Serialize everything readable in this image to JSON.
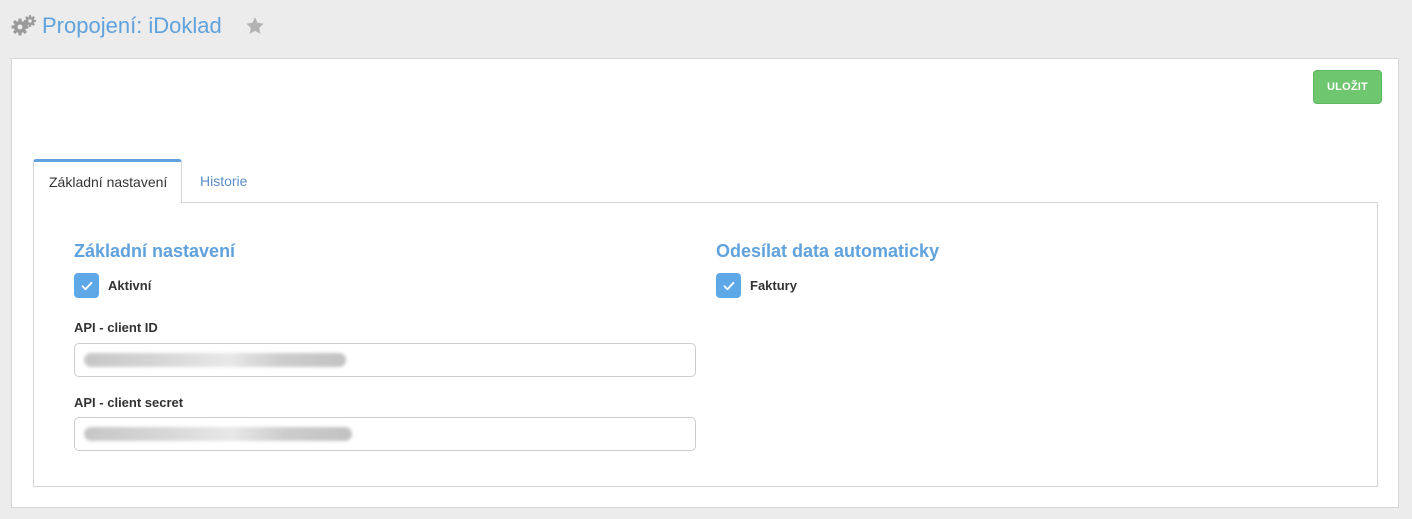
{
  "header": {
    "title": "Propojení: iDoklad",
    "icon": "gears-icon",
    "favorite_icon": "star-icon"
  },
  "toolbar": {
    "save_label": "ULOŽIT"
  },
  "tabs": [
    {
      "label": "Základní nastavení",
      "active": true
    },
    {
      "label": "Historie",
      "active": false
    }
  ],
  "basic_settings": {
    "title": "Základní nastavení",
    "active_checkbox": {
      "label": "Aktivní",
      "checked": true
    },
    "client_id": {
      "label": "API - client ID",
      "value": ""
    },
    "client_secret": {
      "label": "API - client secret",
      "value": ""
    }
  },
  "auto_send": {
    "title": "Odesílat data automaticky",
    "invoices_checkbox": {
      "label": "Faktury",
      "checked": true
    }
  },
  "colors": {
    "accent": "#5fa2dd",
    "save_button": "#6ec66e",
    "checkbox": "#5fa8e8"
  }
}
